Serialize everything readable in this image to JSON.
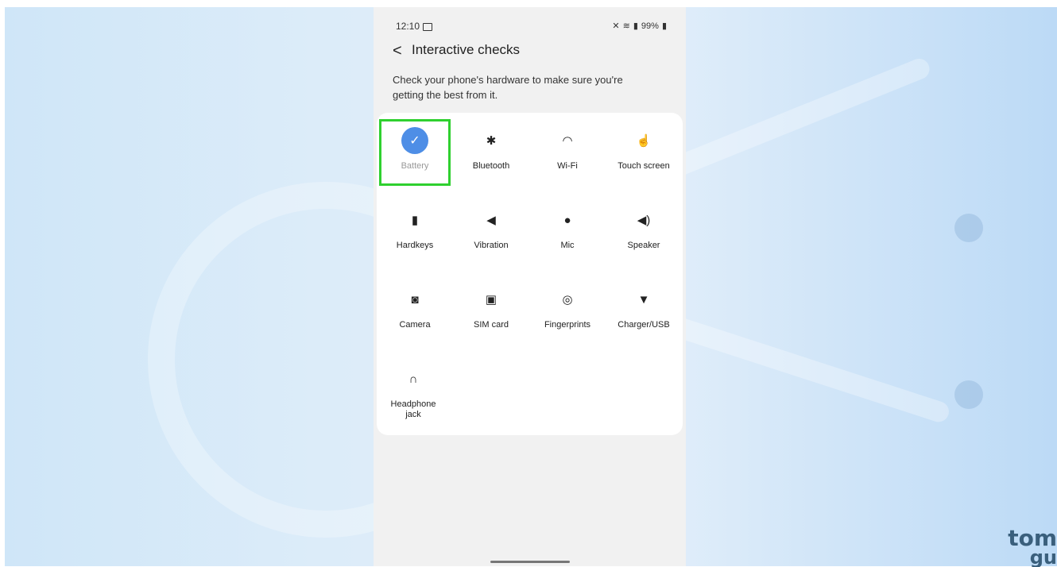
{
  "status_bar": {
    "time": "12:10",
    "battery": "99%"
  },
  "header": {
    "back_glyph": "<",
    "title": "Interactive checks"
  },
  "description": "Check your phone's hardware to make sure you're getting the best from it.",
  "checks": [
    {
      "label": "Battery",
      "icon": "check-icon",
      "glyph": "✓"
    },
    {
      "label": "Bluetooth",
      "icon": "bluetooth-icon",
      "glyph": "✱"
    },
    {
      "label": "Wi-Fi",
      "icon": "wifi-icon",
      "glyph": "◠"
    },
    {
      "label": "Touch screen",
      "icon": "touch-icon",
      "glyph": "☝"
    },
    {
      "label": "Hardkeys",
      "icon": "hardkeys-icon",
      "glyph": "▮"
    },
    {
      "label": "Vibration",
      "icon": "vibration-icon",
      "glyph": "◀"
    },
    {
      "label": "Mic",
      "icon": "mic-icon",
      "glyph": "●"
    },
    {
      "label": "Speaker",
      "icon": "speaker-icon",
      "glyph": "◀)"
    },
    {
      "label": "Camera",
      "icon": "camera-icon",
      "glyph": "◙"
    },
    {
      "label": "SIM card",
      "icon": "sim-card-icon",
      "glyph": "▣"
    },
    {
      "label": "Fingerprints",
      "icon": "fingerprint-icon",
      "glyph": "◎"
    },
    {
      "label": "Charger/USB",
      "icon": "usb-icon",
      "glyph": "▼"
    },
    {
      "label": "Headphone jack",
      "icon": "headphone-icon",
      "glyph": "∩"
    }
  ],
  "brand": {
    "line1": "tom",
    "line2": "gu"
  },
  "colors": {
    "accent": "#4e8ee6",
    "highlight": "#2fd02f",
    "card": "#ffffff",
    "screen": "#f1f1f1"
  }
}
